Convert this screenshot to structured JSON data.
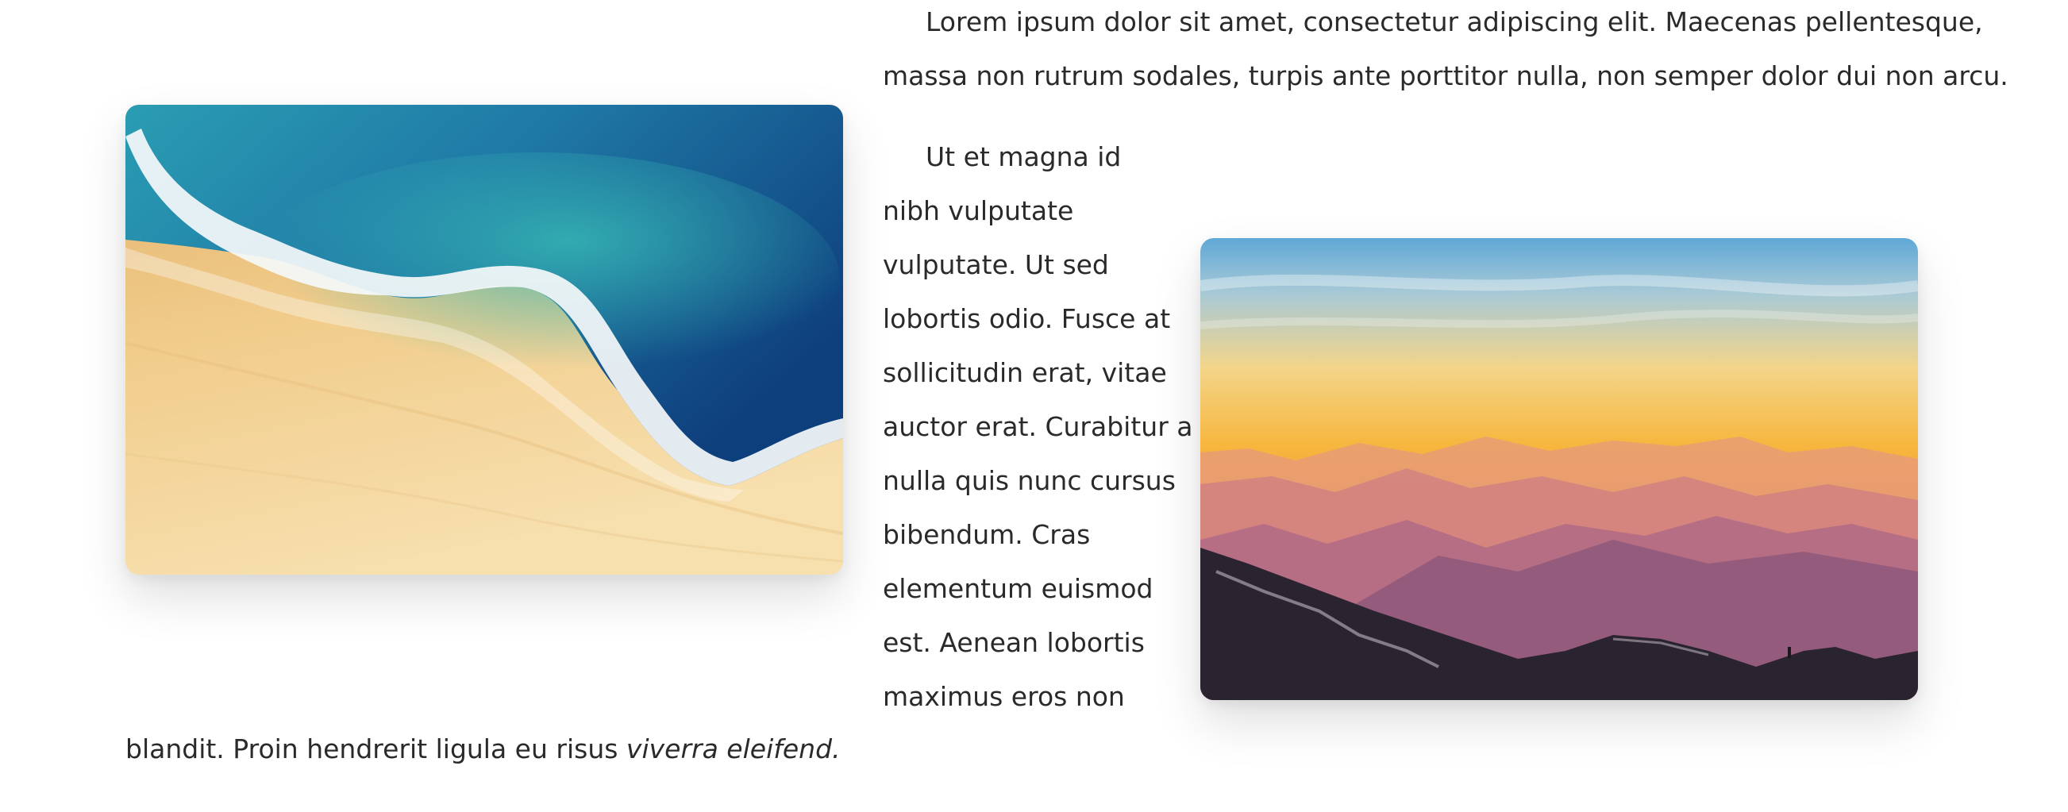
{
  "paragraph_1": {
    "lines": [
      "Lorem ipsum dolor sit amet, consectetur adipiscing elit. Maecenas pellentesque,",
      "massa non rutrum sodales, turpis ante porttitor nulla, non semper dolor dui non arcu."
    ]
  },
  "paragraph_2": {
    "lines": [
      "Ut et magna id",
      "nibh vulputate",
      "vulputate. Ut sed",
      "lobortis odio. Fusce at",
      "sollicitudin erat, vitae",
      "auctor erat. Curabitur a",
      "nulla quis nunc cursus",
      "bibendum. Cras",
      "elementum euismod",
      "est. Aenean lobortis",
      "maximus eros non"
    ],
    "last_line_plain": "blandit. Proin hendrerit ligula eu risus ",
    "last_line_italic": "viverra eleifend."
  },
  "images": {
    "left": "beach-aerial-photo",
    "right": "mountain-sunset-photo"
  }
}
